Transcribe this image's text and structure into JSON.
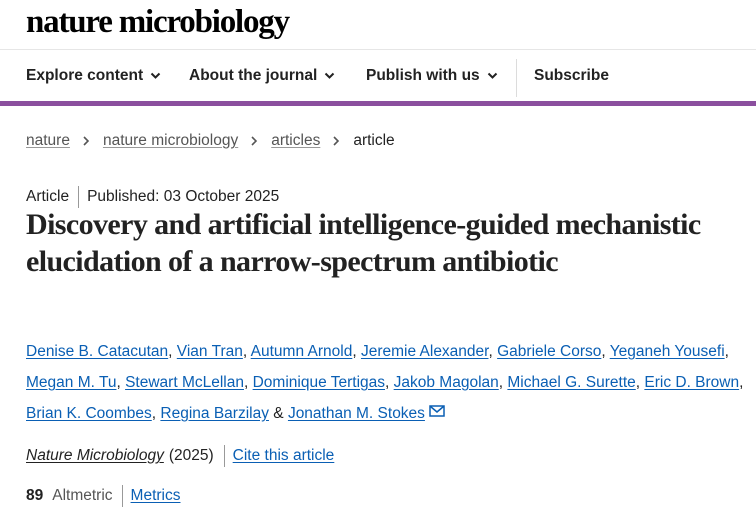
{
  "site": {
    "logo": "nature microbiology"
  },
  "nav": {
    "explore": "Explore content",
    "about": "About the journal",
    "publish": "Publish with us",
    "subscribe": "Subscribe"
  },
  "breadcrumb": {
    "items": [
      "nature",
      "nature microbiology",
      "articles"
    ],
    "current": "article"
  },
  "article": {
    "type": "Article",
    "published": "Published: 03 October 2025",
    "title": "Discovery and artificial intelligence-guided mechanistic elucidation of a narrow-spectrum antibiotic",
    "authors": [
      "Denise B. Catacutan",
      "Vian Tran",
      "Autumn Arnold",
      "Jeremie Alexander",
      "Gabriele Corso",
      "Yeganeh Yousefi",
      "Megan M. Tu",
      "Stewart McLellan",
      "Dominique Tertigas",
      "Jakob Magolan",
      "Michael G. Surette",
      "Eric D. Brown",
      "Brian K. Coombes",
      "Regina Barzilay",
      "Jonathan M. Stokes"
    ],
    "author_separator": ",",
    "author_final_joiner": "&",
    "journal": "Nature Microbiology",
    "year": "(2025)",
    "cite_label": "Cite this article",
    "altmetric_score": "89",
    "altmetric_label": "Altmetric",
    "metrics_label": "Metrics"
  },
  "icons": [
    "chevron-down-icon",
    "chevron-right-icon",
    "mail-icon"
  ],
  "colors": {
    "accent": "#8b4f9e",
    "link": "#0a5fb4",
    "text": "#222222"
  }
}
